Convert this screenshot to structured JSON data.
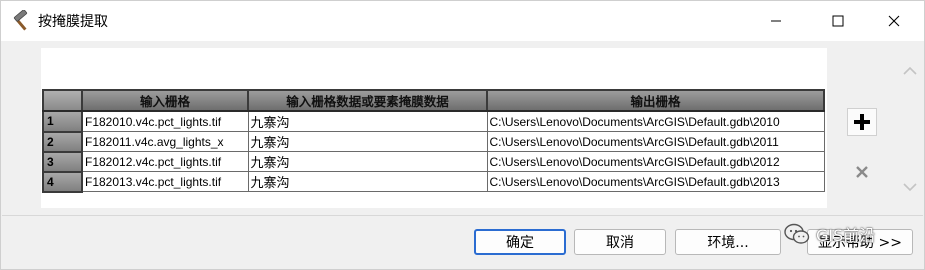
{
  "window": {
    "title": "按掩膜提取"
  },
  "titlebar": {
    "icons": [
      "hammer-icon",
      "minimize-icon",
      "maximize-icon",
      "close-icon"
    ]
  },
  "table": {
    "headers": [
      "输入栅格",
      "输入栅格数据或要素掩膜数据",
      "输出栅格"
    ],
    "rows": [
      {
        "num": "1",
        "input": "F182010.v4c.pct_lights.tif",
        "mask": "九寨沟",
        "output": "C:\\Users\\Lenovo\\Documents\\ArcGIS\\Default.gdb\\2010"
      },
      {
        "num": "2",
        "input": "F182011.v4c.avg_lights_x",
        "mask": "九寨沟",
        "output": "C:\\Users\\Lenovo\\Documents\\ArcGIS\\Default.gdb\\2011"
      },
      {
        "num": "3",
        "input": "F182012.v4c.pct_lights.tif",
        "mask": "九寨沟",
        "output": "C:\\Users\\Lenovo\\Documents\\ArcGIS\\Default.gdb\\2012"
      },
      {
        "num": "4",
        "input": "F182013.v4c.pct_lights.tif",
        "mask": "九寨沟",
        "output": "C:\\Users\\Lenovo\\Documents\\ArcGIS\\Default.gdb\\2013"
      }
    ]
  },
  "side": {
    "add_icon": "plus-icon",
    "remove_icon": "x-icon"
  },
  "buttons": {
    "ok": "确定",
    "cancel": "取消",
    "env": "环境...",
    "help": "显示帮助 >>"
  },
  "watermark": {
    "text": "GIS前沿"
  },
  "colors": {
    "accent": "#2b6cd1",
    "header_bg": "#7f7f7f"
  }
}
